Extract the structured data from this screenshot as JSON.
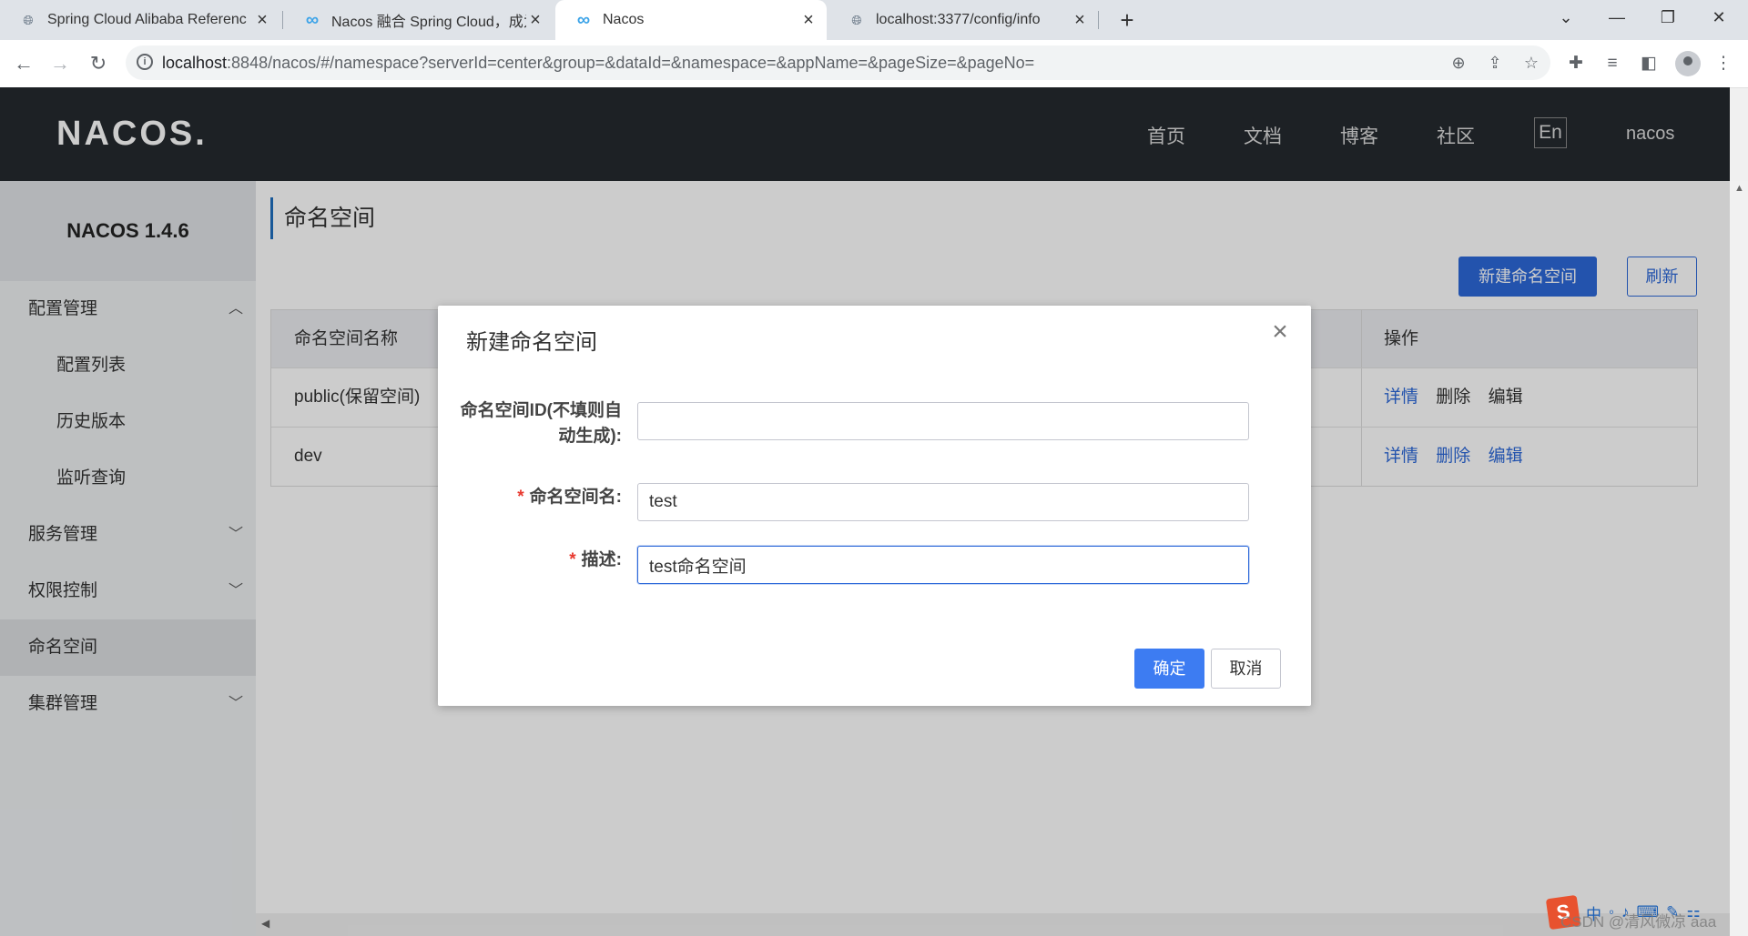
{
  "browser": {
    "tabs": [
      {
        "title": "Spring Cloud Alibaba Referenc",
        "icon": "globe-icon",
        "active": false
      },
      {
        "title": "Nacos 融合 Spring Cloud，成为",
        "icon": "nacos-infinity-icon",
        "active": false
      },
      {
        "title": "Nacos",
        "icon": "nacos-infinity-icon",
        "active": true
      },
      {
        "title": "localhost:3377/config/info",
        "icon": "globe-icon",
        "active": false
      }
    ],
    "url_host": "localhost",
    "url_rest": ":8848/nacos/#/namespace?serverId=center&group=&dataId=&namespace=&appName=&pageSize=&pageNo="
  },
  "header": {
    "logo": "NACOS.",
    "nav": [
      "首页",
      "文档",
      "博客",
      "社区"
    ],
    "lang": "En",
    "user": "nacos"
  },
  "sidebar": {
    "version": "NACOS 1.4.6",
    "items": [
      {
        "label": "配置管理",
        "level": 1,
        "expanded": true
      },
      {
        "label": "配置列表",
        "level": 2
      },
      {
        "label": "历史版本",
        "level": 2
      },
      {
        "label": "监听查询",
        "level": 2
      },
      {
        "label": "服务管理",
        "level": 1,
        "expanded": false
      },
      {
        "label": "权限控制",
        "level": 1,
        "expanded": false
      },
      {
        "label": "命名空间",
        "level": 1,
        "active": true
      },
      {
        "label": "集群管理",
        "level": 1,
        "expanded": false
      }
    ]
  },
  "main": {
    "title": "命名空间",
    "new_button": "新建命名空间",
    "refresh_button": "刷新",
    "table": {
      "headers": [
        "命名空间名称",
        "操作"
      ],
      "rows": [
        {
          "name": "public(保留空间)",
          "ops": [
            "详情",
            "删除",
            "编辑"
          ]
        },
        {
          "name": "dev",
          "ops": [
            "详情",
            "删除",
            "编辑"
          ]
        }
      ]
    }
  },
  "dialog": {
    "title": "新建命名空间",
    "fields": [
      {
        "label": "命名空间ID(不填则自动生成):",
        "required": false,
        "value": ""
      },
      {
        "label": "命名空间名:",
        "required": true,
        "value": "test"
      },
      {
        "label": "描述:",
        "required": true,
        "value": "test命名空间"
      }
    ],
    "required_mark": "*",
    "ok": "确定",
    "cancel": "取消"
  },
  "tray": {
    "ime": "S",
    "lang": "中",
    "watermark": "CSDN @清风微凉 aaa"
  },
  "colors": {
    "primary": "#2c68d9",
    "nav_bg": "#252a2f",
    "required": "#e8392f"
  }
}
